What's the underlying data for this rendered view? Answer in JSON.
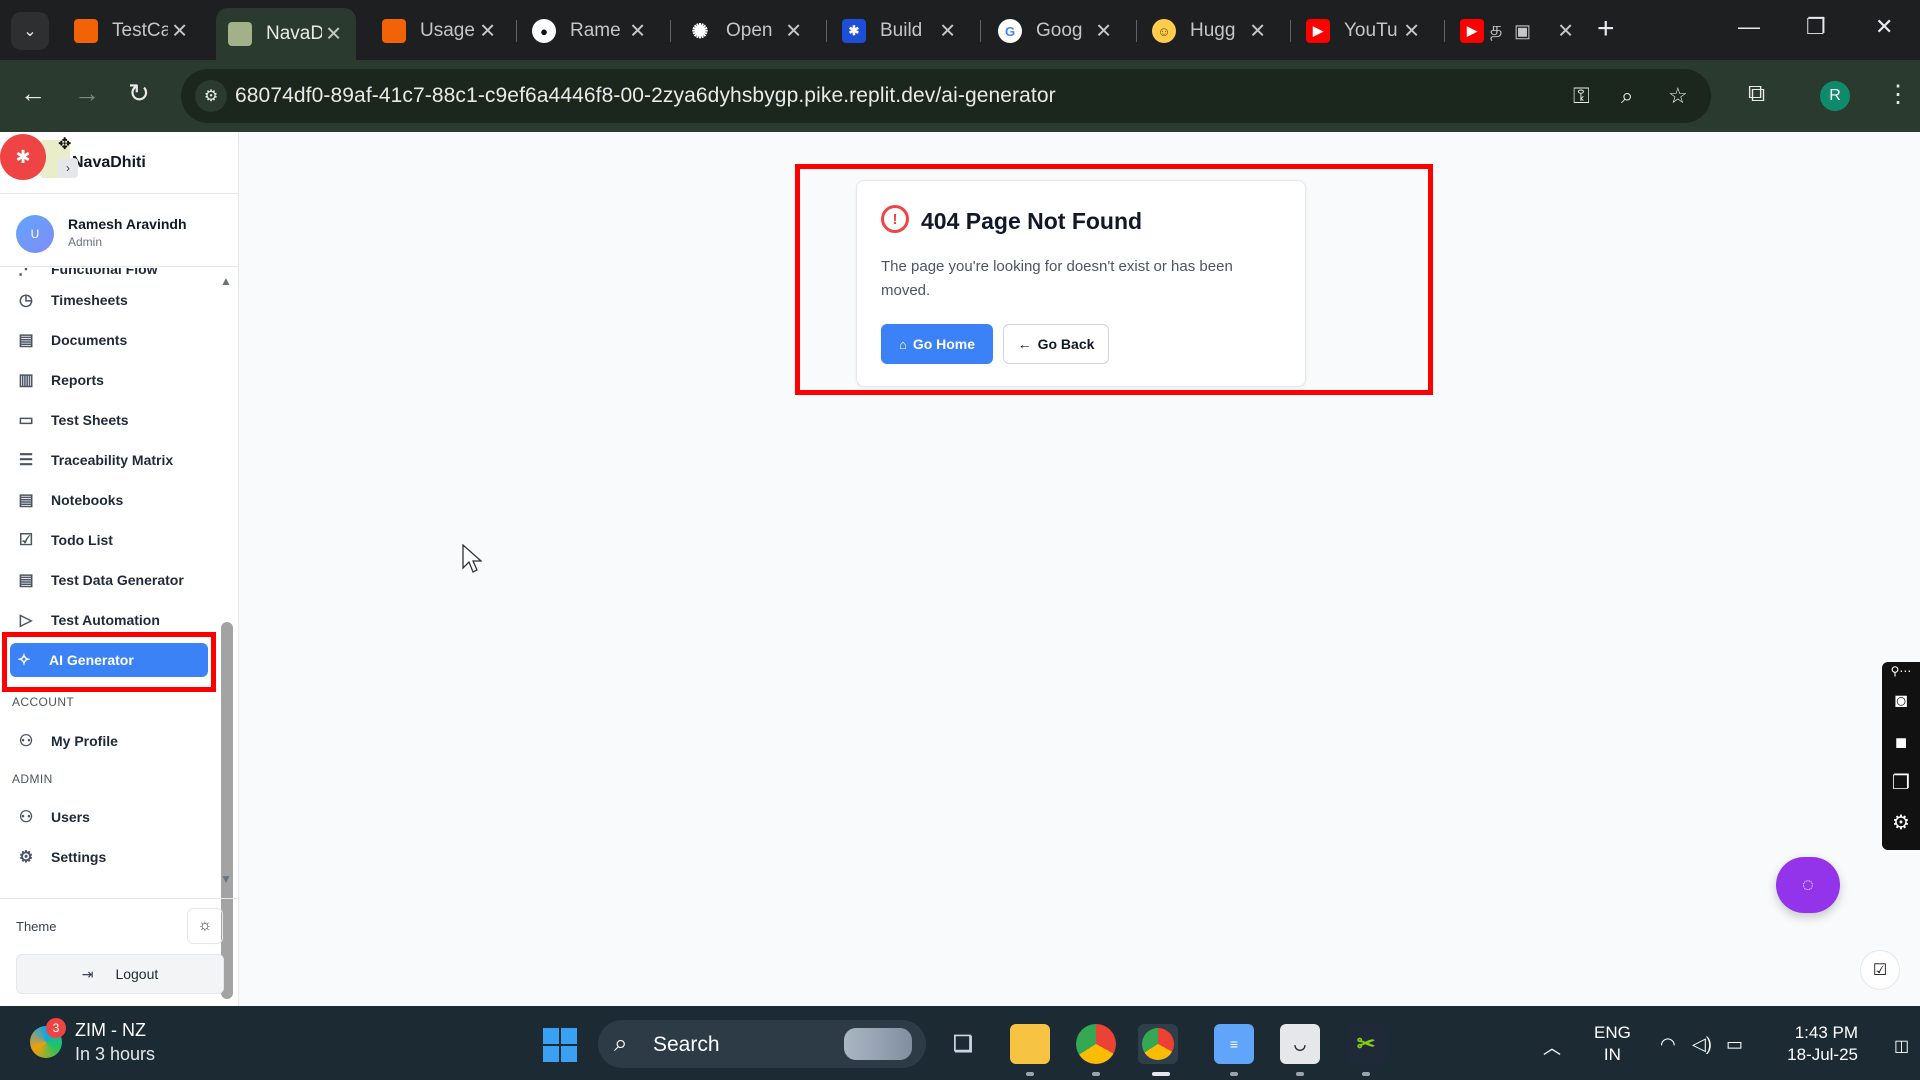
{
  "browser": {
    "tabs": [
      {
        "label": "TestCa",
        "icon": "replit-icon",
        "color": "#f26207"
      },
      {
        "label": "NavaD",
        "icon": "navadhiti-icon",
        "color": "#a3b18a"
      },
      {
        "label": "Usage",
        "icon": "replit-icon",
        "color": "#f26207"
      },
      {
        "label": "Rame",
        "icon": "github-icon",
        "color": "#ffffff"
      },
      {
        "label": "Open",
        "icon": "openai-icon",
        "color": "#ffffff"
      },
      {
        "label": "Build",
        "icon": "bluesky-icon",
        "color": "#1d9bf0"
      },
      {
        "label": "Goog",
        "icon": "google-icon",
        "color": "#4285f4"
      },
      {
        "label": "Hugg",
        "icon": "huggingface-icon",
        "color": "#ffcc4d"
      },
      {
        "label": "YouTu",
        "icon": "youtube-icon",
        "color": "#ff0000"
      },
      {
        "label": "த",
        "icon": "youtube-icon",
        "color": "#ff0000"
      }
    ],
    "url": "68074df0-89af-41c7-88c1-c9ef6a4446f8-00-2zya6dyhsbygp.pike.replit.dev/ai-generator",
    "profile_initial": "R"
  },
  "app": {
    "brand": "NavaDhiti",
    "user": {
      "initial": "U",
      "name": "Ramesh Aravindh",
      "role": "Admin"
    },
    "nav": [
      {
        "label": "Functional Flow",
        "icon": "flow-icon"
      },
      {
        "label": "Timesheets",
        "icon": "clock-icon"
      },
      {
        "label": "Documents",
        "icon": "document-icon"
      },
      {
        "label": "Reports",
        "icon": "report-icon"
      },
      {
        "label": "Test Sheets",
        "icon": "sheet-icon"
      },
      {
        "label": "Traceability Matrix",
        "icon": "filter-icon"
      },
      {
        "label": "Notebooks",
        "icon": "notebook-icon"
      },
      {
        "label": "Todo List",
        "icon": "checkbox-icon"
      },
      {
        "label": "Test Data Generator",
        "icon": "document-icon"
      },
      {
        "label": "Test Automation",
        "icon": "play-icon"
      },
      {
        "label": "AI Generator",
        "icon": "sparkles-icon"
      }
    ],
    "account_heading": "ACCOUNT",
    "account_nav": [
      {
        "label": "My Profile",
        "icon": "users-icon"
      }
    ],
    "admin_heading": "ADMIN",
    "admin_nav": [
      {
        "label": "Users",
        "icon": "users-icon"
      },
      {
        "label": "Settings",
        "icon": "gear-icon"
      }
    ],
    "theme_label": "Theme",
    "logout_label": "Logout",
    "accent": "#3b82f6"
  },
  "error_card": {
    "title": "404 Page Not Found",
    "message": "The page you're looking for doesn't exist or has been moved.",
    "go_home": "Go Home",
    "go_back": "Go Back",
    "icon": "alert-circle-icon"
  },
  "taskbar": {
    "weather_badge": "3",
    "weather_title": "ZIM - NZ",
    "weather_sub": "In 3 hours",
    "search_label": "Search",
    "lang_line1": "ENG",
    "lang_line2": "IN",
    "time": "1:43 PM",
    "date": "18-Jul-25"
  }
}
